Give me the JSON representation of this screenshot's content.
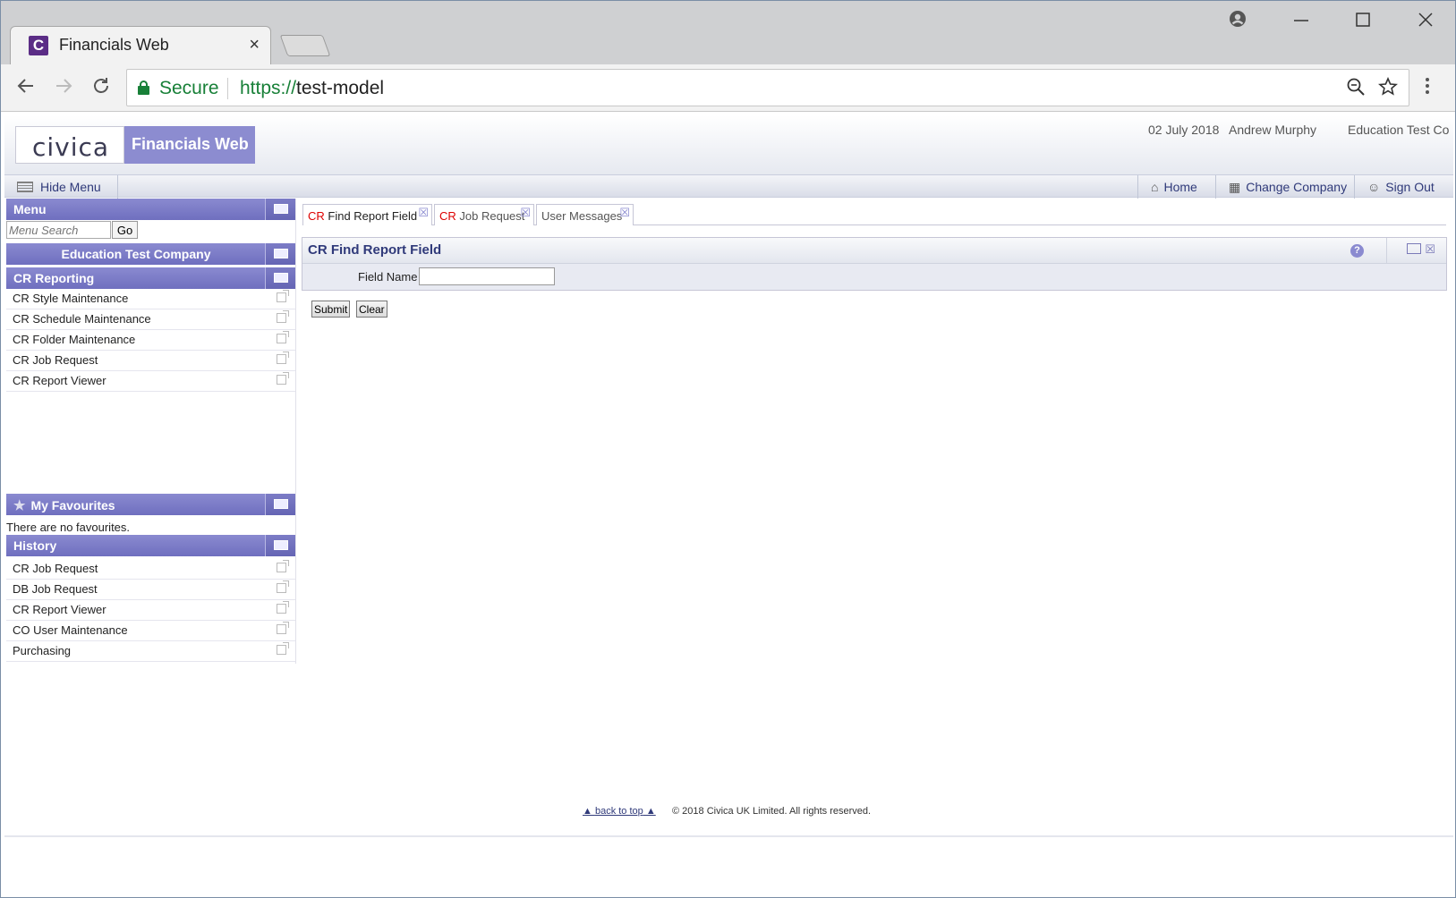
{
  "browser": {
    "tab_title": "Financials Web",
    "tab_favicon": "C",
    "tab_close": "×",
    "omnibox_secure": "Secure",
    "omnibox_scheme": "https://",
    "omnibox_host": "test-model"
  },
  "header": {
    "logo": "civica",
    "product": "Financials Web",
    "date": "02 July 2018",
    "user": "Andrew Murphy",
    "company": "Education Test Co"
  },
  "menubar": {
    "hide_menu": "Hide Menu",
    "home": "Home",
    "change_company": "Change Company",
    "sign_out": "Sign Out"
  },
  "sidebar": {
    "menu_title": "Menu",
    "search_placeholder": "Menu Search",
    "go_label": "Go",
    "company_title": "Education Test Company",
    "module_title": "CR Reporting",
    "module_items": [
      "CR Style Maintenance",
      "CR Schedule Maintenance",
      "CR Folder Maintenance",
      "CR Job Request",
      "CR Report Viewer"
    ],
    "favourites_title": "My Favourites",
    "favourites_empty": "There are no favourites.",
    "history_title": "History",
    "history_items": [
      "CR Job Request",
      "DB Job Request",
      "CR Report Viewer",
      "CO User Maintenance",
      "Purchasing"
    ]
  },
  "content": {
    "tabs": [
      {
        "prefix": "CR",
        "label": " Find Report Field"
      },
      {
        "prefix": "CR",
        "label": " Job Request"
      },
      {
        "prefix": "",
        "label": "User Messages"
      }
    ],
    "panel_title": "CR Find Report Field",
    "field_label": "Field Name",
    "field_value": "",
    "submit_label": "Submit",
    "clear_label": "Clear"
  },
  "footer": {
    "back_to_top": "back to top",
    "copyright": "© 2018 Civica UK Limited. All rights reserved."
  },
  "colors": {
    "brand_purple": "#8c8cd0",
    "link_navy": "#303a7a",
    "secure_green": "#188038",
    "cr_red": "#dd0000"
  }
}
